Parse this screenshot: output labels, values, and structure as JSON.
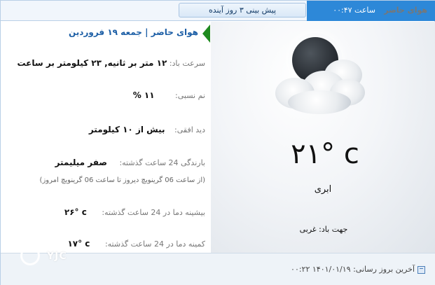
{
  "topbar": {
    "current_tab_label": "هوای حاضر",
    "time_label": "ساعت ۰۰:۴۷",
    "forecast_tab_label": "پیش بینی ۳ روز آینده"
  },
  "visual": {
    "icon": "moon-cloud-icon",
    "temperature": "۲۱° c",
    "condition": "ابری",
    "wind_direction": "جهت باد: غربی"
  },
  "details": {
    "headline": "هوای حاضر | جمعه ۱۹ فروردین",
    "rows": [
      {
        "key": "سرعت باد:",
        "value": "۱۲ متر بر ثانیه, ۲۳ کیلومتر بر ساعت"
      },
      {
        "key": "نم نسبی:",
        "value": "۱۱ %"
      },
      {
        "key": "دید افقی:",
        "value": "بیش از ۱۰ کیلومتر"
      },
      {
        "key": "بارندگی 24 ساعت گذشته:",
        "value": "صفر میلیمتر"
      },
      {
        "key": "بیشینه دما در 24 ساعت گذشته:",
        "value": "۲۶° c"
      },
      {
        "key": "کمینه دما در 24 ساعت گذشته:",
        "value": "۱۷° c"
      }
    ],
    "rain_note": "(از ساعت 06 گرینویچ دیروز تا ساعت 06 گرینویچ امروز)"
  },
  "footer": {
    "last_update": "آخرین بروز رسانی: ۱۴۰۱/۰۱/۱۹ ۰۰:۲۲"
  },
  "watermark": {
    "text": "YJC"
  },
  "colors": {
    "accent": "#2d88d8",
    "headline": "#1d5fa6",
    "arrow": "#1f8a1f"
  }
}
